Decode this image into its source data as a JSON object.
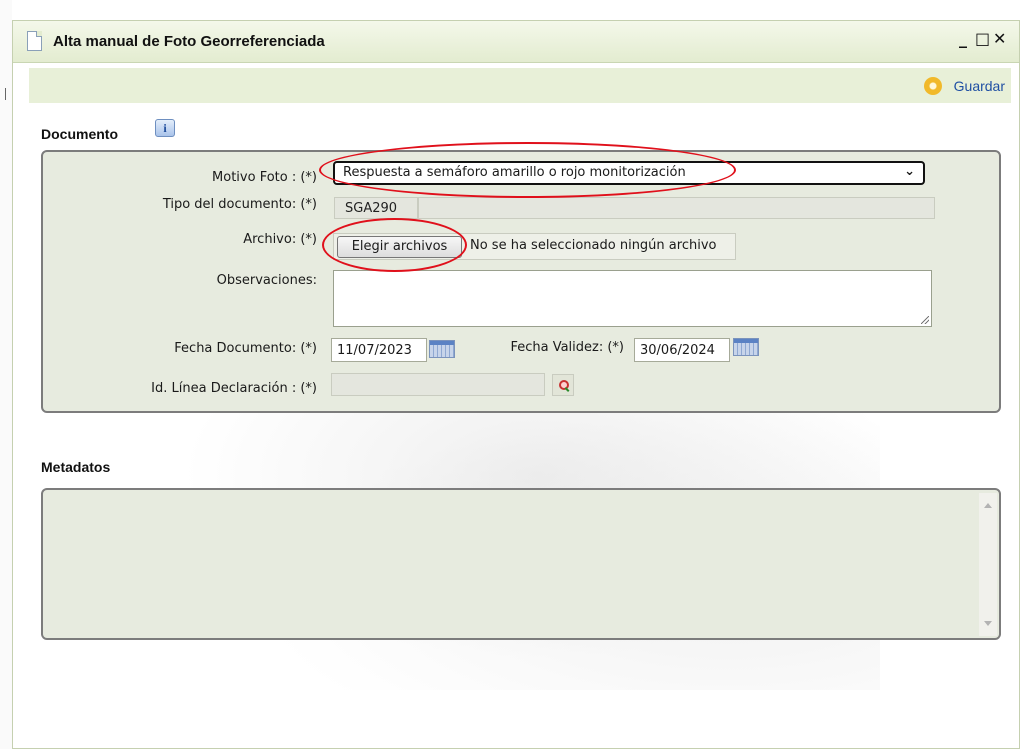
{
  "window": {
    "title": "Alta manual de Foto Georreferenciada",
    "minimize_glyph": "_",
    "maximize_glyph": "□",
    "close_glyph": "✕"
  },
  "toolbar": {
    "save_label": "Guardar",
    "save_icon": "save-disc-icon"
  },
  "documento": {
    "section_title": "Documento",
    "info_icon_glyph": "i",
    "motivo_label": "Motivo Foto : (*)",
    "motivo_value": "Respuesta a semáforo amarillo o rojo monitorización",
    "tipo_label": "Tipo del documento: (*)",
    "tipo_code": "SGA290",
    "tipo_desc": "",
    "archivo_label": "Archivo: (*)",
    "archivo_button": "Elegir archivos",
    "archivo_status": "No se ha seleccionado ningún archivo",
    "observaciones_label": "Observaciones:",
    "observaciones_value": "",
    "fecha_doc_label": "Fecha Documento: (*)",
    "fecha_doc_value": "11/07/2023",
    "fecha_val_label": "Fecha Validez: (*)",
    "fecha_val_value": "30/06/2024",
    "id_linea_label": "Id. Línea Declaración : (*)",
    "id_linea_value": ""
  },
  "metadatos": {
    "section_title": "Metadatos"
  },
  "colors": {
    "titlebar": "#e3ecd0",
    "panel": "#e7ebdf",
    "link": "#1f4fa3",
    "annotation": "#e0101b"
  }
}
